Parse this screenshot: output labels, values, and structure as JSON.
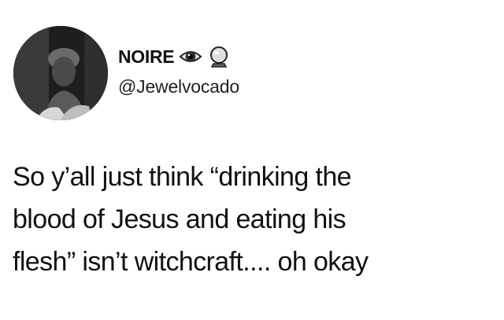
{
  "user": {
    "display_name": "NOIRE",
    "handle": "@Jewelvocado",
    "badges": [
      "eye-emoji-icon",
      "crystal-ball-emoji-icon"
    ]
  },
  "tweet": {
    "lines": [
      "So y’all just think “drinking the",
      "blood of Jesus and eating his",
      "flesh” isn’t witchcraft.... oh okay"
    ]
  },
  "colors": {
    "background": "#ffffff",
    "text": "#111111"
  }
}
